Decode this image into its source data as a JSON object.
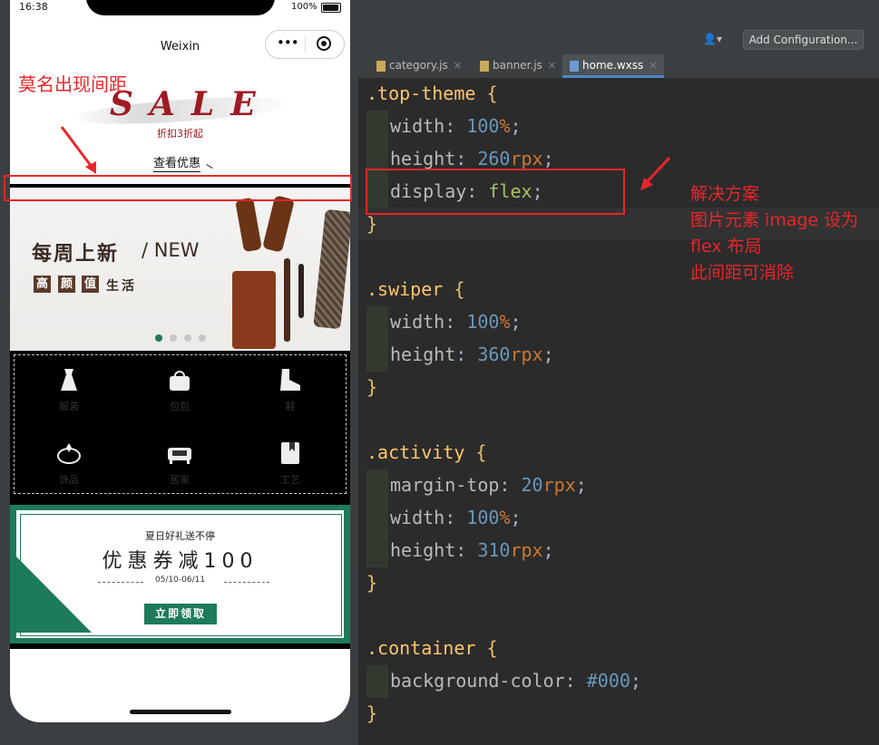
{
  "phone": {
    "status_time": "16:38",
    "battery_pct": "100%",
    "nav_title": "Weixin",
    "top_theme": {
      "headline": "SALE",
      "subtitle": "折扣3折起",
      "link": "查看优惠"
    },
    "swiper": {
      "title": "每周上新",
      "title_en": "/ NEW",
      "tags": [
        "高",
        "颜",
        "值"
      ],
      "tail": "生活",
      "dots": 4,
      "active_dot": 0
    },
    "categories": [
      {
        "label": "服装",
        "icon": "dress-icon"
      },
      {
        "label": "包包",
        "icon": "bag-icon"
      },
      {
        "label": "鞋",
        "icon": "shoe-icon"
      },
      {
        "label": "饰品",
        "icon": "jewelry-icon"
      },
      {
        "label": "居家",
        "icon": "sofa-icon"
      },
      {
        "label": "工艺",
        "icon": "craft-icon"
      }
    ],
    "coupon": {
      "line1": "夏日好礼送不停",
      "line2": "优惠券减100",
      "date": "05/10-06/11",
      "button": "立即领取"
    }
  },
  "annotations": {
    "left": "莫名出现间距",
    "right": [
      "解决方案",
      "图片元素 image 设为",
      "flex 布局",
      "此间距可消除"
    ]
  },
  "ide": {
    "add_configuration": "Add Configuration...",
    "tabs": [
      {
        "label": "category.js",
        "active": false
      },
      {
        "label": "banner.js",
        "active": false
      },
      {
        "label": "home.wxss",
        "active": true
      }
    ]
  },
  "code": [
    {
      "selector": ".top-theme",
      "props": [
        [
          "width",
          "100",
          "%"
        ],
        [
          "height",
          "260",
          "rpx"
        ],
        [
          "display",
          "flex",
          ""
        ]
      ]
    },
    {
      "selector": ".swiper",
      "props": [
        [
          "width",
          "100",
          "%"
        ],
        [
          "height",
          "360",
          "rpx"
        ]
      ]
    },
    {
      "selector": ".activity",
      "props": [
        [
          "margin-top",
          "20",
          "rpx"
        ],
        [
          "width",
          "100",
          "%"
        ],
        [
          "height",
          "310",
          "rpx"
        ]
      ]
    },
    {
      "selector": ".container",
      "props": [
        [
          "background-color",
          "#000",
          ""
        ]
      ]
    }
  ],
  "colors": {
    "accent_green": "#1d7b5a",
    "sale_red": "#9e1b22",
    "annotation_red": "#e8262a"
  }
}
